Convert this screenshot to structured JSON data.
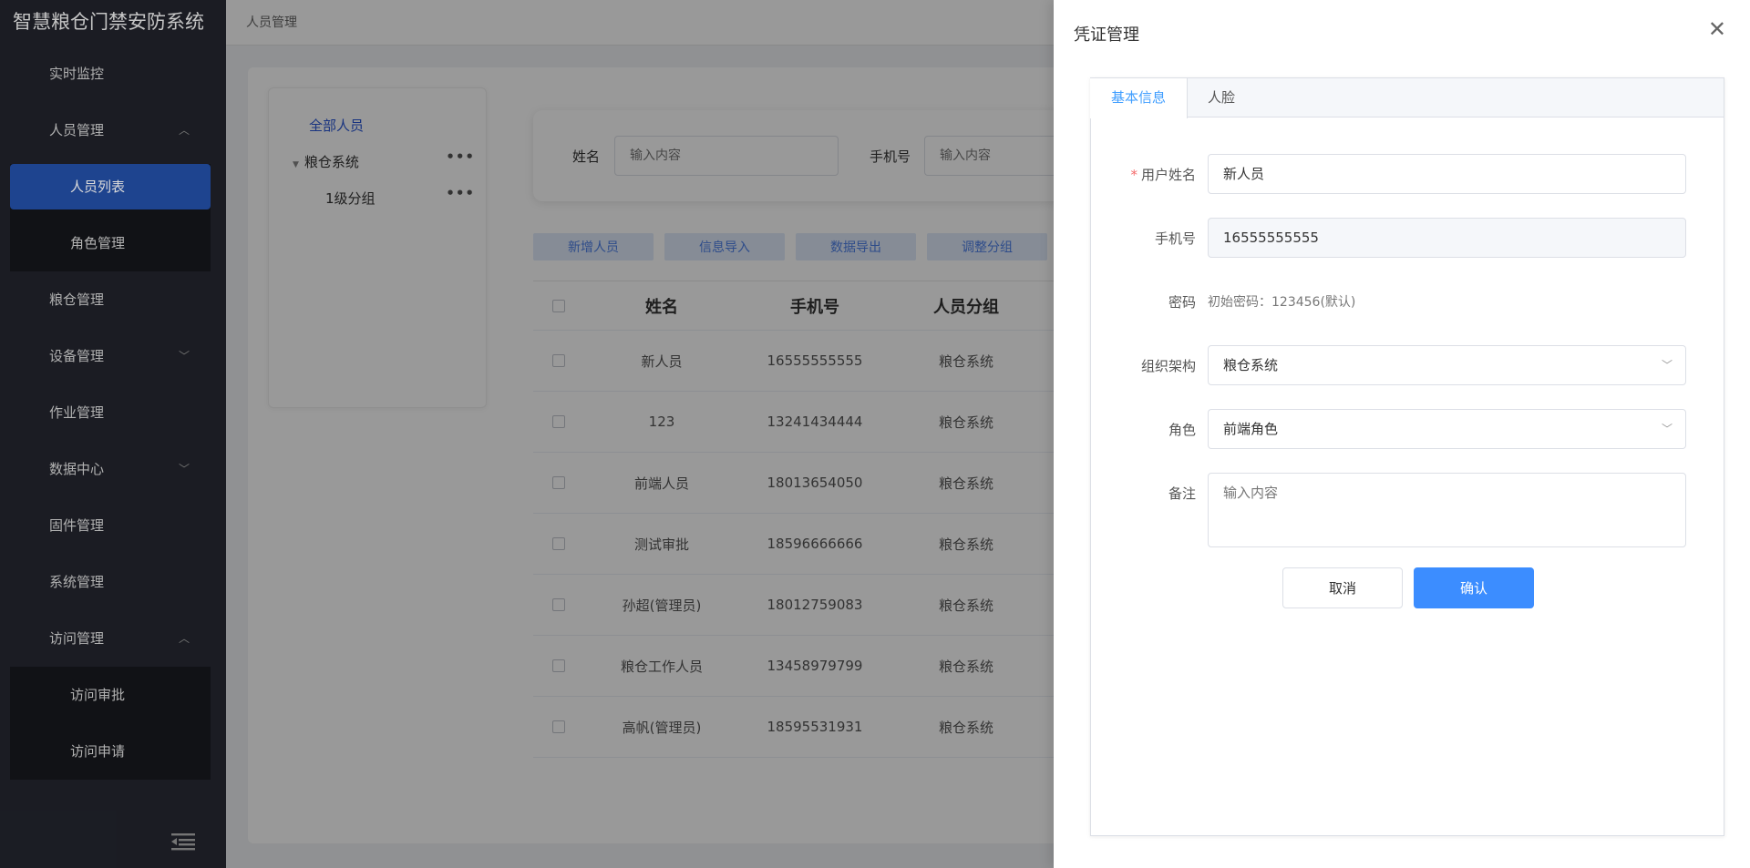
{
  "app": {
    "title": "智慧粮仓门禁安防系统"
  },
  "sidebar": {
    "items": [
      {
        "label": "实时监控"
      },
      {
        "label": "人员管理",
        "expanded": true,
        "children": [
          {
            "label": "人员列表",
            "active": true
          },
          {
            "label": "角色管理"
          }
        ]
      },
      {
        "label": "粮仓管理"
      },
      {
        "label": "设备管理"
      },
      {
        "label": "作业管理"
      },
      {
        "label": "数据中心"
      },
      {
        "label": "固件管理"
      },
      {
        "label": "系统管理"
      },
      {
        "label": "访问管理",
        "expanded": true,
        "children": [
          {
            "label": "访问审批"
          },
          {
            "label": "访问申请"
          }
        ]
      }
    ],
    "collapse_icon": "menu-fold-icon"
  },
  "breadcrumb": "人员管理",
  "tree": {
    "all_label": "全部人员",
    "nodes": [
      {
        "label": "粮仓系统"
      },
      {
        "label": "1级分组"
      }
    ],
    "more_glyph": "•••"
  },
  "search": {
    "name_label": "姓名",
    "name_placeholder": "输入内容",
    "phone_label": "手机号",
    "phone_placeholder": "输入内容"
  },
  "actions": [
    "新增人员",
    "信息导入",
    "数据导出",
    "调整分组"
  ],
  "table": {
    "columns": [
      "姓名",
      "手机号",
      "人员分组"
    ],
    "rows": [
      [
        "新人员",
        "16555555555",
        "粮仓系统"
      ],
      [
        "123",
        "13241434444",
        "粮仓系统"
      ],
      [
        "前端人员",
        "18013654050",
        "粮仓系统"
      ],
      [
        "测试审批",
        "18596666666",
        "粮仓系统"
      ],
      [
        "孙超(管理员)",
        "18012759083",
        "粮仓系统"
      ],
      [
        "粮仓工作人员",
        "13458979799",
        "粮仓系统"
      ],
      [
        "高帆(管理员)",
        "18595531931",
        "粮仓系统"
      ]
    ]
  },
  "drawer": {
    "title": "凭证管理",
    "close_glyph": "✕",
    "tabs": [
      {
        "label": "基本信息",
        "active": true
      },
      {
        "label": "人脸"
      }
    ],
    "form": {
      "username": {
        "label": "用户姓名",
        "required_mark": "*",
        "value": "新人员"
      },
      "phone": {
        "label": "手机号",
        "value": "16555555555"
      },
      "password": {
        "label": "密码",
        "hint": "初始密码：123456(默认)"
      },
      "org": {
        "label": "组织架构",
        "value": "粮仓系统"
      },
      "role": {
        "label": "角色",
        "value": "前端角色"
      },
      "remark": {
        "label": "备注",
        "placeholder": "输入内容"
      }
    },
    "cancel_label": "取消",
    "confirm_label": "确认"
  },
  "colors": {
    "primary": "#3c8dff",
    "sidebar_bg": "#20222a",
    "active_menu": "#2450a8",
    "required": "#f56c6c"
  }
}
